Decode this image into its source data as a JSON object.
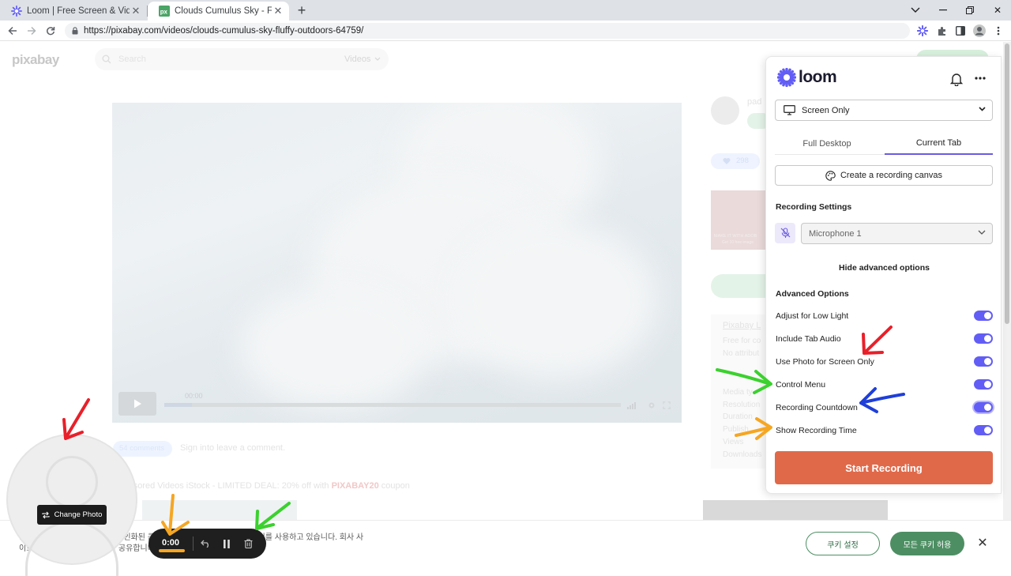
{
  "browser": {
    "tabs": [
      {
        "title": "Loom | Free Screen & Video Re",
        "active": false
      },
      {
        "title": "Clouds Cumulus Sky - Free vide",
        "active": true
      }
    ],
    "url": "https://pixabay.com/videos/clouds-cumulus-sky-fluffy-outdoors-64759/"
  },
  "pixabay": {
    "logo": "pixabay",
    "search_placeholder": "Search",
    "search_type": "Videos",
    "video_time": "00:00",
    "author": "pad",
    "likes": "298",
    "comments": "54 comments",
    "signin": "Sign in",
    "leave_comment": " to leave a comment.",
    "sponsored": "Sponsored Videos iStock - LIMITED DEAL: 20% off with ",
    "coupon": "PIXABAY20",
    "coupon_suffix": " coupon",
    "license_title": "Pixabay L",
    "license_line1": "Free for co",
    "license_line2": "No attribut",
    "meta": [
      "Media ty",
      "Resolution",
      "Duration",
      "Publish",
      "Views",
      "Downloads"
    ],
    "ad_text1": "MAKE IT WITH ADOB",
    "ad_text2": "Get 10 free image"
  },
  "cookie_bar": {
    "text_line1": "… 재생화과 데이… 제작하고 개인화된 콘텐츠와 광고를 제공하기 위해 쿠키를 사용하고 있습니다. 회사 사",
    "text_line2": "이트 … 도를 회사… 파트너와 공유합니다.",
    "settings_label": "쿠키 설정",
    "allow_label": "모든 쿠키 허용"
  },
  "camera": {
    "change_photo_label": "Change Photo"
  },
  "control_menu": {
    "time": "0:00"
  },
  "loom": {
    "brand": "loom",
    "source_select": "Screen Only",
    "tabs": [
      {
        "label": "Full Desktop",
        "active": false
      },
      {
        "label": "Current Tab",
        "active": true
      }
    ],
    "canvas_button": "Create a recording canvas",
    "recording_settings_title": "Recording Settings",
    "microphone": "Microphone 1",
    "hide_advanced": "Hide advanced options",
    "advanced_title": "Advanced Options",
    "options": [
      {
        "label": "Adjust for Low Light",
        "on": true
      },
      {
        "label": "Include Tab Audio",
        "on": true
      },
      {
        "label": "Use Photo for Screen Only",
        "on": true
      },
      {
        "label": "Control Menu",
        "on": true
      },
      {
        "label": "Recording Countdown",
        "on": true
      },
      {
        "label": "Show Recording Time",
        "on": true
      }
    ],
    "start_button": "Start Recording",
    "accent": "#625df5",
    "start_color": "#e0694a"
  },
  "annotation_colors": {
    "red": "#e8202a",
    "green": "#3bd12e",
    "blue": "#1f3fd8",
    "orange": "#f5a623"
  }
}
